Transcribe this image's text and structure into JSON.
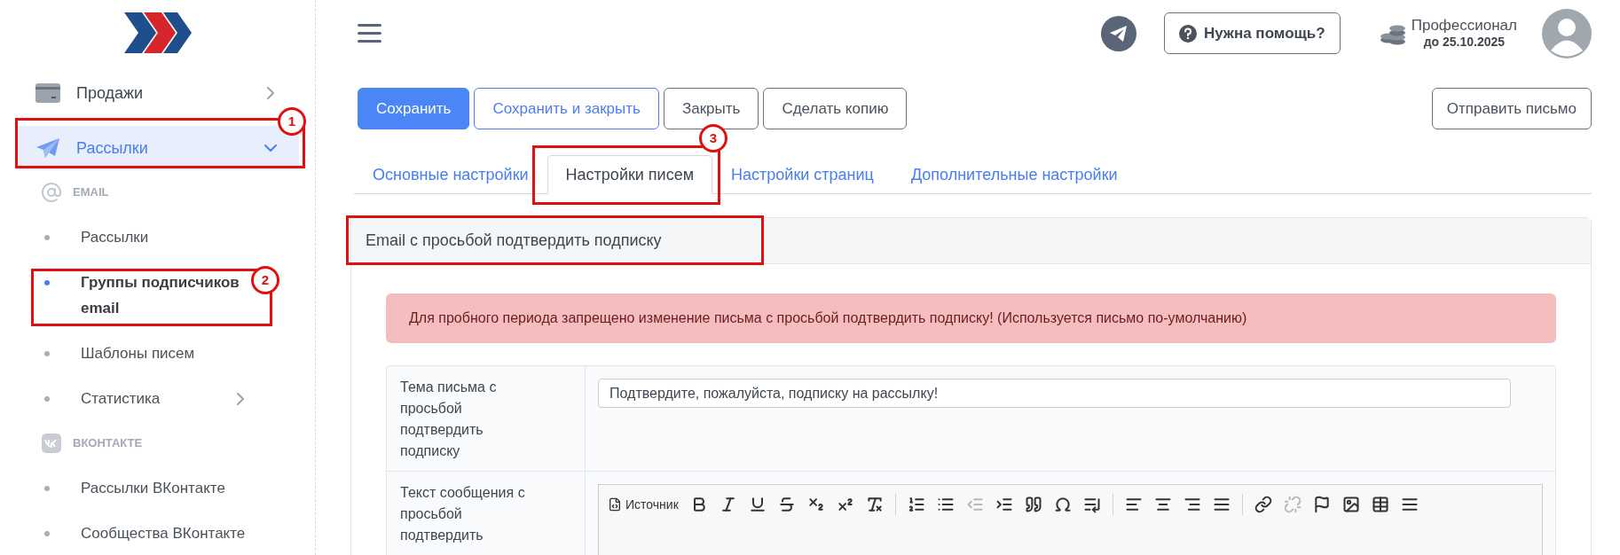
{
  "sidebar": {
    "items": [
      {
        "kind": "menu",
        "label": "Продажи",
        "selected": false,
        "expanded": false
      },
      {
        "kind": "menu",
        "label": "Рассылки",
        "selected": true,
        "expanded": true
      },
      {
        "kind": "section",
        "label": "EMAIL"
      },
      {
        "kind": "sub",
        "label": "Рассылки",
        "selected": false
      },
      {
        "kind": "sub",
        "label": "Группы подписчиков email",
        "selected": true
      },
      {
        "kind": "sub",
        "label": "Шаблоны писем",
        "selected": false
      },
      {
        "kind": "sub",
        "label": "Статистика",
        "selected": false,
        "expanded": false
      },
      {
        "kind": "section",
        "label": "ВКОНТАКТЕ"
      },
      {
        "kind": "sub",
        "label": "Рассылки ВКонтакте",
        "selected": false
      },
      {
        "kind": "sub",
        "label": "Сообщества ВКонтакте",
        "selected": false
      }
    ]
  },
  "header": {
    "help_button": "Нужна помощь?",
    "plan": {
      "name": "Профессионал",
      "until": "до 25.10.2025"
    }
  },
  "actions": [
    {
      "kind": "primary",
      "label": "Сохранить"
    },
    {
      "kind": "secondary",
      "label": "Сохранить и закрыть"
    },
    {
      "kind": "plain",
      "label": "Закрыть"
    },
    {
      "kind": "plain",
      "label": "Сделать копию"
    }
  ],
  "send_button": "Отправить письмо",
  "tabs": [
    {
      "label": "Основные настройки",
      "selected": false
    },
    {
      "label": "Настройки писем",
      "selected": true
    },
    {
      "label": "Настройки страниц",
      "selected": false
    },
    {
      "label": "Дополнительные настройки",
      "selected": false
    }
  ],
  "card": {
    "title": "Email с просьбой подтвердить подписку",
    "alert": "Для пробного периода запрещено изменение письма с просьбой подтвердить подписку! (Используется письмо по-умолчанию)",
    "rows": [
      {
        "kind": "input",
        "label": "Тема письма с просьбой подтвердить подписку",
        "value": "Подтвердите, пожалуйста, подписку на рассылку!"
      },
      {
        "kind": "editor",
        "label": "Текст сообщения с просьбой подтвердить",
        "source_button": "Источник"
      }
    ]
  },
  "annotations": [
    {
      "kind": "numbered",
      "number": "1"
    },
    {
      "kind": "numbered",
      "number": "2"
    },
    {
      "kind": "numbered",
      "number": "3"
    },
    {
      "kind": "frame"
    }
  ]
}
